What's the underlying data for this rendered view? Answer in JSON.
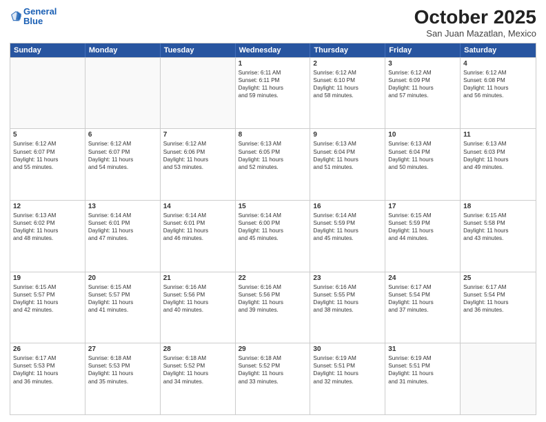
{
  "logo": {
    "line1": "General",
    "line2": "Blue"
  },
  "header": {
    "month": "October 2025",
    "location": "San Juan Mazatlan, Mexico"
  },
  "days": [
    "Sunday",
    "Monday",
    "Tuesday",
    "Wednesday",
    "Thursday",
    "Friday",
    "Saturday"
  ],
  "rows": [
    [
      {
        "num": "",
        "lines": [],
        "empty": true
      },
      {
        "num": "",
        "lines": [],
        "empty": true
      },
      {
        "num": "",
        "lines": [],
        "empty": true
      },
      {
        "num": "1",
        "lines": [
          "Sunrise: 6:11 AM",
          "Sunset: 6:11 PM",
          "Daylight: 11 hours",
          "and 59 minutes."
        ]
      },
      {
        "num": "2",
        "lines": [
          "Sunrise: 6:12 AM",
          "Sunset: 6:10 PM",
          "Daylight: 11 hours",
          "and 58 minutes."
        ]
      },
      {
        "num": "3",
        "lines": [
          "Sunrise: 6:12 AM",
          "Sunset: 6:09 PM",
          "Daylight: 11 hours",
          "and 57 minutes."
        ]
      },
      {
        "num": "4",
        "lines": [
          "Sunrise: 6:12 AM",
          "Sunset: 6:08 PM",
          "Daylight: 11 hours",
          "and 56 minutes."
        ]
      }
    ],
    [
      {
        "num": "5",
        "lines": [
          "Sunrise: 6:12 AM",
          "Sunset: 6:07 PM",
          "Daylight: 11 hours",
          "and 55 minutes."
        ]
      },
      {
        "num": "6",
        "lines": [
          "Sunrise: 6:12 AM",
          "Sunset: 6:07 PM",
          "Daylight: 11 hours",
          "and 54 minutes."
        ]
      },
      {
        "num": "7",
        "lines": [
          "Sunrise: 6:12 AM",
          "Sunset: 6:06 PM",
          "Daylight: 11 hours",
          "and 53 minutes."
        ]
      },
      {
        "num": "8",
        "lines": [
          "Sunrise: 6:13 AM",
          "Sunset: 6:05 PM",
          "Daylight: 11 hours",
          "and 52 minutes."
        ]
      },
      {
        "num": "9",
        "lines": [
          "Sunrise: 6:13 AM",
          "Sunset: 6:04 PM",
          "Daylight: 11 hours",
          "and 51 minutes."
        ]
      },
      {
        "num": "10",
        "lines": [
          "Sunrise: 6:13 AM",
          "Sunset: 6:04 PM",
          "Daylight: 11 hours",
          "and 50 minutes."
        ]
      },
      {
        "num": "11",
        "lines": [
          "Sunrise: 6:13 AM",
          "Sunset: 6:03 PM",
          "Daylight: 11 hours",
          "and 49 minutes."
        ]
      }
    ],
    [
      {
        "num": "12",
        "lines": [
          "Sunrise: 6:13 AM",
          "Sunset: 6:02 PM",
          "Daylight: 11 hours",
          "and 48 minutes."
        ]
      },
      {
        "num": "13",
        "lines": [
          "Sunrise: 6:14 AM",
          "Sunset: 6:01 PM",
          "Daylight: 11 hours",
          "and 47 minutes."
        ]
      },
      {
        "num": "14",
        "lines": [
          "Sunrise: 6:14 AM",
          "Sunset: 6:01 PM",
          "Daylight: 11 hours",
          "and 46 minutes."
        ]
      },
      {
        "num": "15",
        "lines": [
          "Sunrise: 6:14 AM",
          "Sunset: 6:00 PM",
          "Daylight: 11 hours",
          "and 45 minutes."
        ]
      },
      {
        "num": "16",
        "lines": [
          "Sunrise: 6:14 AM",
          "Sunset: 5:59 PM",
          "Daylight: 11 hours",
          "and 45 minutes."
        ]
      },
      {
        "num": "17",
        "lines": [
          "Sunrise: 6:15 AM",
          "Sunset: 5:59 PM",
          "Daylight: 11 hours",
          "and 44 minutes."
        ]
      },
      {
        "num": "18",
        "lines": [
          "Sunrise: 6:15 AM",
          "Sunset: 5:58 PM",
          "Daylight: 11 hours",
          "and 43 minutes."
        ]
      }
    ],
    [
      {
        "num": "19",
        "lines": [
          "Sunrise: 6:15 AM",
          "Sunset: 5:57 PM",
          "Daylight: 11 hours",
          "and 42 minutes."
        ]
      },
      {
        "num": "20",
        "lines": [
          "Sunrise: 6:15 AM",
          "Sunset: 5:57 PM",
          "Daylight: 11 hours",
          "and 41 minutes."
        ]
      },
      {
        "num": "21",
        "lines": [
          "Sunrise: 6:16 AM",
          "Sunset: 5:56 PM",
          "Daylight: 11 hours",
          "and 40 minutes."
        ]
      },
      {
        "num": "22",
        "lines": [
          "Sunrise: 6:16 AM",
          "Sunset: 5:56 PM",
          "Daylight: 11 hours",
          "and 39 minutes."
        ]
      },
      {
        "num": "23",
        "lines": [
          "Sunrise: 6:16 AM",
          "Sunset: 5:55 PM",
          "Daylight: 11 hours",
          "and 38 minutes."
        ]
      },
      {
        "num": "24",
        "lines": [
          "Sunrise: 6:17 AM",
          "Sunset: 5:54 PM",
          "Daylight: 11 hours",
          "and 37 minutes."
        ]
      },
      {
        "num": "25",
        "lines": [
          "Sunrise: 6:17 AM",
          "Sunset: 5:54 PM",
          "Daylight: 11 hours",
          "and 36 minutes."
        ]
      }
    ],
    [
      {
        "num": "26",
        "lines": [
          "Sunrise: 6:17 AM",
          "Sunset: 5:53 PM",
          "Daylight: 11 hours",
          "and 36 minutes."
        ]
      },
      {
        "num": "27",
        "lines": [
          "Sunrise: 6:18 AM",
          "Sunset: 5:53 PM",
          "Daylight: 11 hours",
          "and 35 minutes."
        ]
      },
      {
        "num": "28",
        "lines": [
          "Sunrise: 6:18 AM",
          "Sunset: 5:52 PM",
          "Daylight: 11 hours",
          "and 34 minutes."
        ]
      },
      {
        "num": "29",
        "lines": [
          "Sunrise: 6:18 AM",
          "Sunset: 5:52 PM",
          "Daylight: 11 hours",
          "and 33 minutes."
        ]
      },
      {
        "num": "30",
        "lines": [
          "Sunrise: 6:19 AM",
          "Sunset: 5:51 PM",
          "Daylight: 11 hours",
          "and 32 minutes."
        ]
      },
      {
        "num": "31",
        "lines": [
          "Sunrise: 6:19 AM",
          "Sunset: 5:51 PM",
          "Daylight: 11 hours",
          "and 31 minutes."
        ]
      },
      {
        "num": "",
        "lines": [],
        "empty": true
      }
    ]
  ]
}
